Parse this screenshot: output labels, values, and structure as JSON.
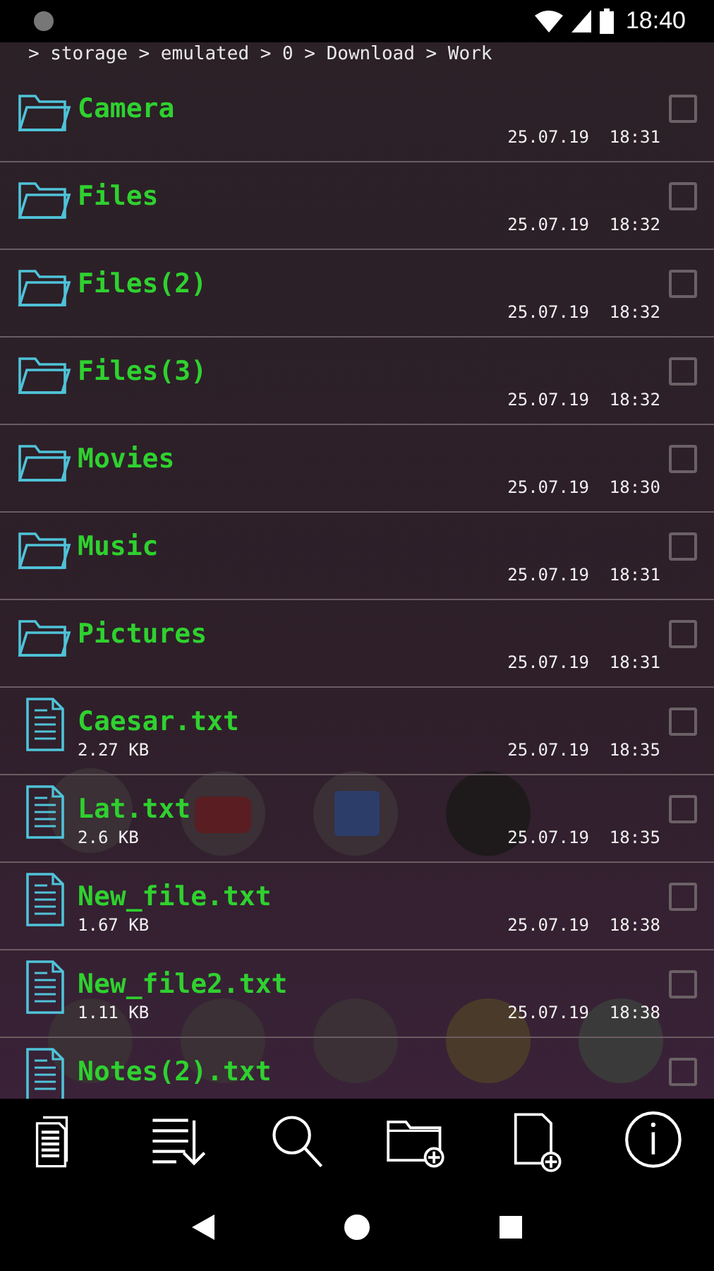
{
  "status_bar": {
    "time": "18:40"
  },
  "breadcrumb": "> storage > emulated > 0 > Download > Work",
  "files": [
    {
      "kind": "folder",
      "name": "Camera",
      "date": "25.07.19  18:31",
      "checked": false
    },
    {
      "kind": "folder",
      "name": "Files",
      "date": "25.07.19  18:32",
      "checked": false
    },
    {
      "kind": "folder",
      "name": "Files(2)",
      "date": "25.07.19  18:32",
      "checked": false
    },
    {
      "kind": "folder",
      "name": "Files(3)",
      "date": "25.07.19  18:32",
      "checked": false
    },
    {
      "kind": "folder",
      "name": "Movies",
      "date": "25.07.19  18:30",
      "checked": false
    },
    {
      "kind": "folder",
      "name": "Music",
      "date": "25.07.19  18:31",
      "checked": false
    },
    {
      "kind": "folder",
      "name": "Pictures",
      "date": "25.07.19  18:31",
      "checked": false
    },
    {
      "kind": "file",
      "name": "Caesar.txt",
      "size": "2.27 KB",
      "date": "25.07.19  18:35",
      "checked": false
    },
    {
      "kind": "file",
      "name": "Lat.txt",
      "size": "2.6 KB",
      "date": "25.07.19  18:35",
      "checked": false
    },
    {
      "kind": "file",
      "name": "New_file.txt",
      "size": "1.67 KB",
      "date": "25.07.19  18:38",
      "checked": false
    },
    {
      "kind": "file",
      "name": "New_file2.txt",
      "size": "1.11 KB",
      "date": "25.07.19  18:38",
      "checked": false
    },
    {
      "kind": "file",
      "name": "Notes(2).txt",
      "checked": false
    }
  ],
  "toolbar": [
    {
      "kind": "documents"
    },
    {
      "kind": "sort"
    },
    {
      "kind": "search"
    },
    {
      "kind": "new_folder"
    },
    {
      "kind": "new_file"
    },
    {
      "kind": "info"
    }
  ]
}
